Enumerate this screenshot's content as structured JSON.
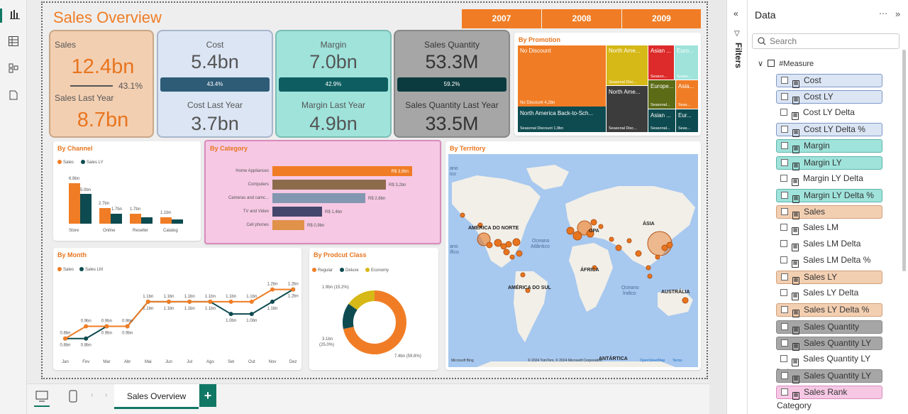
{
  "report": {
    "title": "Sales Overview"
  },
  "years": [
    "2007",
    "2008",
    "2009"
  ],
  "kpis": {
    "sales": {
      "label": "Sales",
      "value": "12.4bn",
      "pct": "43.1%",
      "ly_label": "Sales Last Year",
      "ly_value": "8.7bn"
    },
    "cost": {
      "label": "Cost",
      "value": "5.4bn",
      "pct": "43.4%",
      "ly_label": "Cost Last Year",
      "ly_value": "3.7bn"
    },
    "margin": {
      "label": "Margin",
      "value": "7.0bn",
      "pct": "42.9%",
      "ly_label": "Margin Last Year",
      "ly_value": "4.9bn"
    },
    "qty": {
      "label": "Sales Quantity",
      "value": "53.3M",
      "pct": "59.2%",
      "ly_label": "Sales Quantity Last Year",
      "ly_value": "33.5M"
    }
  },
  "promotion": {
    "title": "By Promotion",
    "cells": {
      "no_discount": "No Discount",
      "no_discount_val": "No Discount 4,2bn",
      "north_ame1": "North Ame...",
      "seasonal1": "Seasonal Disc...",
      "asian1": "Asian ...",
      "seasonal_a": "Season...",
      "euro1": "Euro...",
      "seaso1": "Seaso...",
      "north_ame2": "North Ame...",
      "europe": "Europe...",
      "seasonal_e": "Seasonal...",
      "asia2": "Asia...",
      "seas2": "Seas...",
      "na_back": "North America Back-to-Sch...",
      "seasonal_disc": "Seasonal Discount 1,9bn",
      "seasonal2": "Seasonal Disc...",
      "asian2": "Asian ...",
      "seasonal3": "Seasonal...",
      "eur": "Eur...",
      "seas3": "Seas..."
    }
  },
  "channel": {
    "title": "By Channel",
    "legend": [
      "Sales",
      "Sales LY"
    ],
    "categories": [
      "Store",
      "Online",
      "Reseller",
      "Catalog"
    ],
    "labels": [
      "6.9bn",
      "5.0bn",
      "2.7bn",
      "1.7bn",
      "1.7bn",
      "1.1bn"
    ]
  },
  "category": {
    "title": "By Category",
    "items": [
      {
        "name": "Home Appliances",
        "label": "R$ 3,9bn"
      },
      {
        "name": "Computers",
        "label": "R$ 3,2bn"
      },
      {
        "name": "Cameras and camc...",
        "label": "R$ 2,6bn"
      },
      {
        "name": "TV and Video",
        "label": "R$ 1,4bn"
      },
      {
        "name": "Cell phones",
        "label": "R$ 0,9bn"
      }
    ]
  },
  "territory": {
    "title": "By Territory",
    "labels": {
      "na": "AMÉRICA DO NORTE",
      "sa": "AMÉRICA DO SUL",
      "eu": "OPA",
      "asia": "ÁSIA",
      "africa": "ÁFRICA",
      "oceania": "AUSTRÁLIA",
      "antarctica": "ANTÁRTICA",
      "atl1": "Oceano",
      "atl2": "Atlântico",
      "ind1": "Oceano",
      "ind2": "Índico",
      "pac1": "ano",
      "pac2": "ico",
      "pac3": "ano",
      "pac4": "ífico"
    },
    "credit": "© 2024 TomTom, © 2024 Microsoft Corporation",
    "osm": "OpenStreetMap",
    "terms": "Terms",
    "bing": "Microsoft Bing"
  },
  "month": {
    "title": "By Month",
    "legend": [
      "Sales",
      "Sales LM"
    ],
    "months": [
      "Jan",
      "Fev",
      "Mar",
      "Abr",
      "Mai",
      "Jun",
      "Jul",
      "Ago",
      "Set",
      "Out",
      "Nov",
      "Dez"
    ],
    "sales": [
      0.8,
      0.9,
      0.9,
      0.9,
      1.1,
      1.1,
      1.1,
      1.1,
      1.1,
      1.1,
      1.2,
      1.2
    ],
    "lm": [
      0.8,
      0.8,
      0.9,
      0.9,
      1.1,
      1.1,
      1.1,
      1.1,
      1.0,
      1.0,
      1.1,
      1.2
    ]
  },
  "prodclass": {
    "title": "By Prodcut Class",
    "legend": [
      "Regular",
      "Deluxe",
      "Economy"
    ],
    "labels": {
      "a": "1.9bn (15.2%)",
      "b1": "3.1bn",
      "b2": "(25.0%)",
      "c": "7.4bn (59.8%)"
    }
  },
  "tabs": {
    "page": "Sales Overview",
    "add": "+"
  },
  "filters": {
    "label": "Filters"
  },
  "data": {
    "title": "Data",
    "search_placeholder": "Search",
    "table": "#Measure",
    "fields": [
      "Cost",
      "Cost LY",
      "Cost LY Delta",
      "Cost LY Delta %",
      "Margin",
      "Margin LY",
      "Margin LY Delta",
      "Margin LY Delta %",
      "Sales",
      "Sales LM",
      "Sales LM Delta",
      "Sales LM Delta %",
      "Sales LY",
      "Sales LY Delta",
      "Sales LY Delta %",
      "Sales Quantity",
      "Sales Quantity LY",
      "Sales Quantity LY Delta",
      "Sales Quantity LY Delta %",
      "Sales Rank Category"
    ]
  },
  "colors": {
    "orange": "#f07d25",
    "teal": "#0e4b50",
    "cyan": "#9fe3db",
    "blue": "#dbe5f4",
    "peach": "#f3cfb2",
    "gray": "#a6a6a6",
    "pink": "#f6c8e4"
  }
}
